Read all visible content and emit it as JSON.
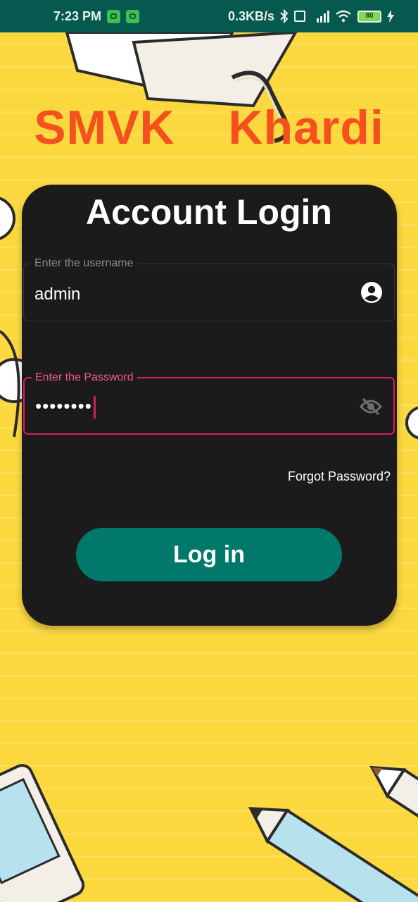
{
  "status_bar": {
    "time": "7:23 PM",
    "network_speed": "0.3KB/s",
    "battery": "80",
    "icons": [
      "app-notification-icon",
      "app-notification-icon",
      "bluetooth-icon",
      "volte-icon",
      "4g-signal-icon",
      "wifi-icon",
      "battery-icon",
      "charging-icon"
    ]
  },
  "app": {
    "title": "SMVK  Khardi"
  },
  "login_card": {
    "heading": "Account Login",
    "username": {
      "label": "Enter the username",
      "value": "admin",
      "icon": "account-circle-icon"
    },
    "password": {
      "label": "Enter the Password",
      "value": "••••••••",
      "icon": "visibility-off-icon"
    },
    "forgot_password": "Forgot Password?",
    "login_button": "Log in"
  },
  "colors": {
    "status_bar": "#05594f",
    "background": "#fcd83f",
    "title": "#f4511e",
    "card": "#1c1b1c",
    "focus_accent": "#d81b60",
    "button": "#00796b"
  }
}
